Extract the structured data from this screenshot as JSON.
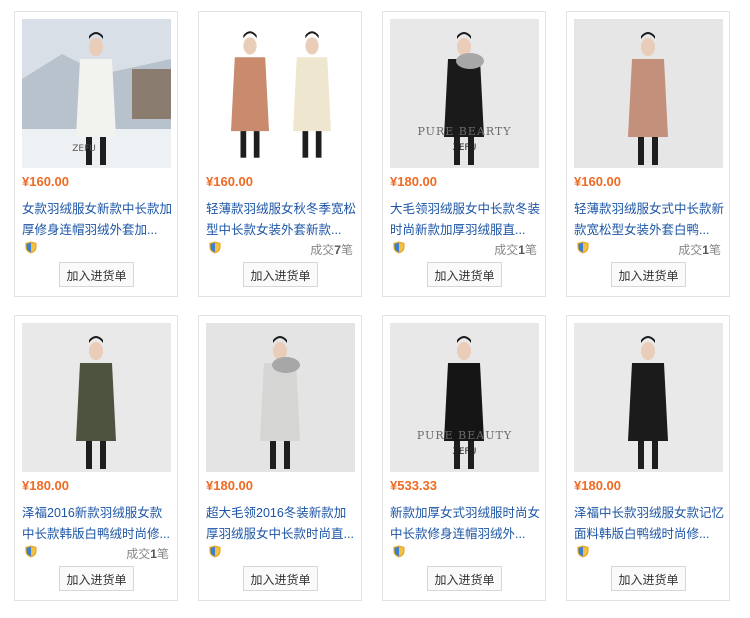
{
  "products": [
    {
      "price": "¥160.00",
      "title": "女款羽绒服女新款中长款加厚修身连帽羽绒外套加...",
      "deals_prefix": "",
      "deals_count": "",
      "deals_suffix": "",
      "button_label": "加入进货单",
      "image": {
        "bg": "#c9d3de",
        "coat": "#f2f2ef",
        "scene": "outdoor-snow",
        "watermark": "ZEFU",
        "brand": ""
      }
    },
    {
      "price": "¥160.00",
      "title": "轻薄款羽绒服女秋冬季宽松型中长款女装外套新款...",
      "deals_prefix": "成交",
      "deals_count": "7",
      "deals_suffix": "笔",
      "button_label": "加入进货单",
      "image": {
        "bg": "#ffffff",
        "coat": "#c98a6e",
        "scene": "two-models",
        "watermark": "",
        "brand": ""
      }
    },
    {
      "price": "¥180.00",
      "title": "大毛领羽绒服女中长款冬装时尚新款加厚羽绒服直...",
      "deals_prefix": "成交",
      "deals_count": "1",
      "deals_suffix": "笔",
      "button_label": "加入进货单",
      "image": {
        "bg": "#e8e8e8",
        "coat": "#1a1a1a",
        "scene": "studio-fur",
        "watermark": "ZEFU",
        "brand": "PURE BEARTY"
      }
    },
    {
      "price": "¥160.00",
      "title": "轻薄款羽绒服女式中长款新款宽松型女装外套白鸭...",
      "deals_prefix": "成交",
      "deals_count": "1",
      "deals_suffix": "笔",
      "button_label": "加入进货单",
      "image": {
        "bg": "#e6e6e6",
        "coat": "#c3907c",
        "scene": "studio",
        "watermark": "",
        "brand": ""
      }
    },
    {
      "price": "¥180.00",
      "title": "泽福2016新款羽绒服女款中长款韩版白鸭绒时尚修...",
      "deals_prefix": "成交",
      "deals_count": "1",
      "deals_suffix": "笔",
      "button_label": "加入进货单",
      "image": {
        "bg": "#e9e9e9",
        "coat": "#4e5340",
        "scene": "studio",
        "watermark": "",
        "brand": ""
      }
    },
    {
      "price": "¥180.00",
      "title": "超大毛领2016冬装新款加厚羽绒服女中长款时尚直...",
      "deals_prefix": "",
      "deals_count": "",
      "deals_suffix": "",
      "button_label": "加入进货单",
      "image": {
        "bg": "#e4e4e4",
        "coat": "#d5d5d3",
        "scene": "studio-fur",
        "watermark": "",
        "brand": ""
      }
    },
    {
      "price": "¥533.33",
      "title": "新款加厚女式羽绒服时尚女中长款修身连帽羽绒外...",
      "deals_prefix": "",
      "deals_count": "",
      "deals_suffix": "",
      "button_label": "加入进货单",
      "image": {
        "bg": "#e8e8e8",
        "coat": "#151515",
        "scene": "studio-side",
        "watermark": "ZEFU",
        "brand": "PURE BEAUTY"
      }
    },
    {
      "price": "¥180.00",
      "title": "泽福中长款羽绒服女款记忆面料韩版白鸭绒时尚修...",
      "deals_prefix": "",
      "deals_count": "",
      "deals_suffix": "",
      "button_label": "加入进货单",
      "image": {
        "bg": "#e9e9e9",
        "coat": "#1b1b1b",
        "scene": "studio",
        "watermark": "",
        "brand": ""
      }
    }
  ],
  "icons": {
    "verified": "shield-icon"
  },
  "colors": {
    "price": "#f06a22",
    "title_link": "#1c55a6",
    "deals_text": "#888888",
    "card_border": "#e3e3e3"
  }
}
